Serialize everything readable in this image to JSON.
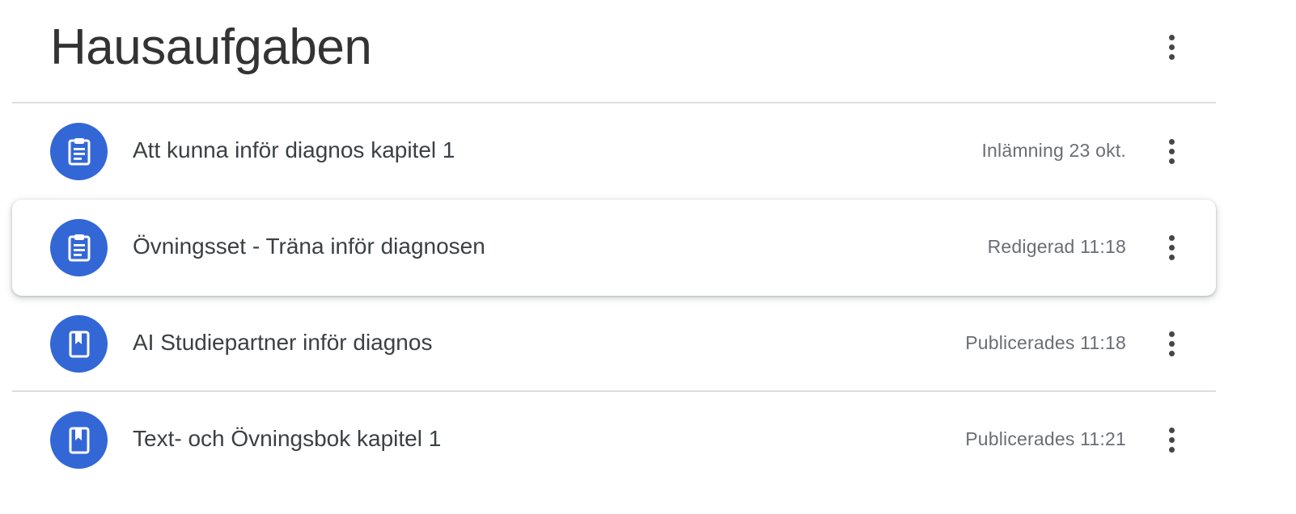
{
  "topic": {
    "title": "Hausaufgaben",
    "menu_icon": "more-vert-icon"
  },
  "items": [
    {
      "title": "Att kunna inför diagnos kapitel 1",
      "meta": "Inlämning 23 okt.",
      "icon": "assignment-icon"
    },
    {
      "title": "Övningsset - Träna inför diagnosen",
      "meta": "Redigerad 11:18",
      "icon": "assignment-icon"
    },
    {
      "title": "AI Studiepartner inför diagnos",
      "meta": "Publicerades 11:18",
      "icon": "material-icon"
    },
    {
      "title": "Text- och Övningsbok kapitel 1",
      "meta": "Publicerades 11:21",
      "icon": "material-icon"
    }
  ],
  "colors": {
    "accent": "#3367d6",
    "divider": "#dadce0",
    "title_text": "#3c4043",
    "meta_text": "#6b6e72"
  }
}
